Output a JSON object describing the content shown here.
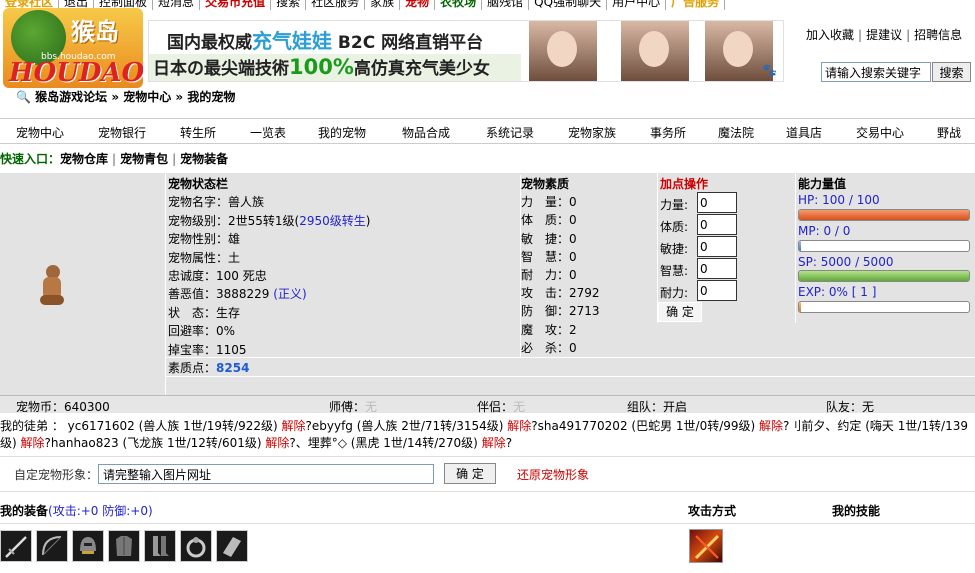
{
  "topnav": [
    {
      "label": "登录社区",
      "style": "orange"
    },
    {
      "label": "退出",
      "style": ""
    },
    {
      "label": "控制面板",
      "style": ""
    },
    {
      "label": "短消息",
      "style": ""
    },
    {
      "label": "交易市充值",
      "style": "red"
    },
    {
      "label": "搜索",
      "style": ""
    },
    {
      "label": "社区服务",
      "style": ""
    },
    {
      "label": "家族",
      "style": ""
    },
    {
      "label": "宠物",
      "style": "red"
    },
    {
      "label": "农牧场",
      "style": "green"
    },
    {
      "label": "脑残馆",
      "style": ""
    },
    {
      "label": "QQ强制聊天",
      "style": ""
    },
    {
      "label": "用户中心",
      "style": ""
    },
    {
      "label": "广告服务",
      "style": "orange"
    }
  ],
  "logo": {
    "cn": "猴岛",
    "en": "HOUDAO",
    "url": "bbs.houdao.com"
  },
  "banner": {
    "line1_pre": "国内最权威",
    "line1_hl": "充气娃娃",
    "line1_post": " B2C 网络直销平台",
    "line2_pre": "日本の最尖端技術",
    "line2_hl": "100%",
    "line2_post": "高仿真充气美少女"
  },
  "header_links": [
    "加入收藏",
    "提建议",
    "招聘信息"
  ],
  "search": {
    "placeholder": "请输入搜索关键字",
    "button": "搜索"
  },
  "breadcrumb": {
    "icon": "🔍",
    "text": "猴岛游戏论坛 » 宠物中心 » 我的宠物"
  },
  "mainnav": [
    "宠物中心",
    "宠物银行",
    "转生所",
    "一览表",
    "我的宠物",
    "物品合成",
    "系统记录",
    "宠物家族",
    "事务所",
    "魔法院",
    "道具店",
    "交易中心",
    "野战"
  ],
  "quick": {
    "label": "快速入口：",
    "links": [
      "宠物仓库",
      "宠物青包",
      "宠物装备"
    ]
  },
  "status": {
    "title": "宠物状态栏",
    "name": "宠物名字：兽人族",
    "level_pre": "宠物级别：2世55转1级(",
    "level_link": "2950级转生",
    "level_post": ")",
    "gender": "宠物性别：雄",
    "attribute": "宠物属性：土",
    "loyalty": "忠诚度：100 死忠",
    "karma_pre": "善恶值：3888229 ",
    "karma_link": "(正义)",
    "state": "状　态：生存",
    "evade": "回避率：0%",
    "drop": "掉宝率：1105",
    "points_label": "素质点：",
    "points_value": "8254"
  },
  "quality": {
    "title": "宠物素质",
    "rows": [
      "力　量：0",
      "体　质：0",
      "敏　捷：0",
      "智　慧：0",
      "耐　力：0",
      "攻　击：2792",
      "防　御：2713",
      "魔　攻：2",
      "必　杀：0"
    ]
  },
  "addpoints": {
    "title": "加点操作",
    "rows": [
      {
        "label": "力量:",
        "value": "0"
      },
      {
        "label": "体质:",
        "value": "0"
      },
      {
        "label": "敏捷:",
        "value": "0"
      },
      {
        "label": "智慧:",
        "value": "0"
      },
      {
        "label": "耐力:",
        "value": "0"
      }
    ],
    "confirm": "确 定"
  },
  "ability": {
    "title": "能力量值",
    "hp_label": "HP:  100 / 100",
    "hp_fraction": 1.0,
    "mp_label": "MP:  0 / 0",
    "mp_fraction": 0.0,
    "sp_label": "SP:  5000 / 5000",
    "sp_fraction": 1.0,
    "exp_label": "EXP:  0% [ 1 ]",
    "exp_fraction": 0.0
  },
  "inforow": {
    "coins": "宠物币：640300",
    "master_label": "师傅：",
    "master_value": "无",
    "partner_label": "伴侣：",
    "partner_value": "无",
    "team_label": "组队：",
    "team_value": "开启",
    "mate_label": "队友：",
    "mate_value": "无"
  },
  "apprentices": {
    "line1": [
      {
        "t": "我的徒弟  ：  yc6171602 (兽人族 1世/19转/922级) ",
        "c": ""
      },
      {
        "t": "解除",
        "c": "red"
      },
      {
        "t": "?ebyyfg (兽人族 2世/71转/3154级) ",
        "c": ""
      },
      {
        "t": "解除",
        "c": "red"
      },
      {
        "t": "?sha491770202 (巴蛇男 1世/0转/99级) ",
        "c": ""
      },
      {
        "t": "解除",
        "c": "red"
      },
      {
        "t": "?刂前夕、约定 (嗨天 1世/1转/139",
        "c": ""
      }
    ],
    "line2": [
      {
        "t": "级) ",
        "c": ""
      },
      {
        "t": "解除",
        "c": "red"
      },
      {
        "t": "?hanhao823 (飞龙族 1世/12转/601级) ",
        "c": ""
      },
      {
        "t": "解除",
        "c": "red"
      },
      {
        "t": "?、埋葬°◇ (黑虎 1世/14转/270级) ",
        "c": ""
      },
      {
        "t": "解除",
        "c": "red"
      },
      {
        "t": "?",
        "c": ""
      }
    ]
  },
  "custom": {
    "label": "自定宠物形象：",
    "input_value": "请完整输入图片网址",
    "button": "确 定",
    "restore": "还原宠物形象"
  },
  "equip": {
    "title": "我的装备",
    "stats": "(攻击:+0 防御:+0)",
    "attack_title": "攻击方式",
    "skill_title": "我的技能"
  }
}
